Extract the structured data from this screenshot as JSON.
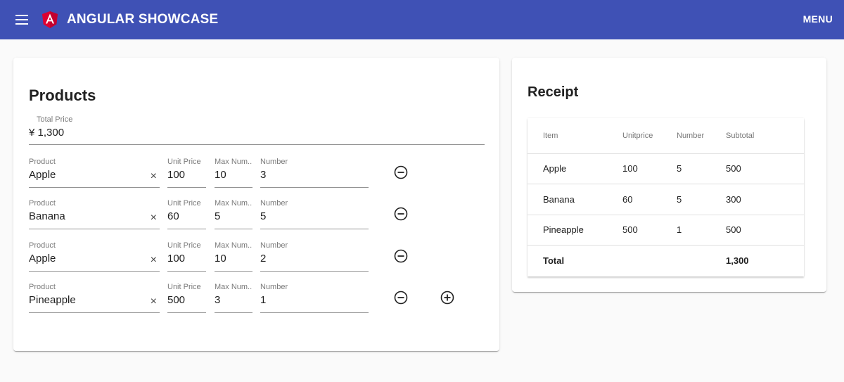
{
  "toolbar": {
    "title": "ANGULAR SHOWCASE",
    "menu_label": "MENU",
    "color": "#3f51b5"
  },
  "products": {
    "title": "Products",
    "total": {
      "label": "Total Price",
      "value": "¥ 1,300"
    },
    "labels": {
      "product": "Product",
      "unit_price": "Unit Price",
      "max_num": "Max Num...",
      "number": "Number"
    },
    "rows": [
      {
        "product": "Apple",
        "unit_price": "100",
        "max_num": "10",
        "number": "3"
      },
      {
        "product": "Banana",
        "unit_price": "60",
        "max_num": "5",
        "number": "5"
      },
      {
        "product": "Apple",
        "unit_price": "100",
        "max_num": "10",
        "number": "2"
      },
      {
        "product": "Pineapple",
        "unit_price": "500",
        "max_num": "3",
        "number": "1"
      }
    ],
    "clear_glyph": "×"
  },
  "receipt": {
    "title": "Receipt",
    "headers": [
      "Item",
      "Unitprice",
      "Number",
      "Subtotal"
    ],
    "rows": [
      [
        "Apple",
        "100",
        "5",
        "500"
      ],
      [
        "Banana",
        "60",
        "5",
        "300"
      ],
      [
        "Pineapple",
        "500",
        "1",
        "500"
      ]
    ],
    "total_label": "Total",
    "total_value": "1,300"
  }
}
